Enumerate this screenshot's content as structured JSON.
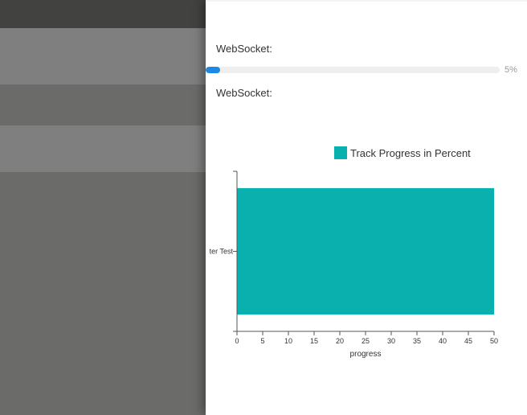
{
  "background": {
    "topbar_color": "#424240",
    "row_color": "#7f7f7f",
    "base_color": "#6b6b69"
  },
  "drawer": {
    "ws_label_1": "WebSocket:",
    "ws_label_2": "WebSocket:",
    "progress": {
      "value_percent": 5,
      "text": "5%",
      "fill_color": "#1e88e5"
    }
  },
  "chart_data": {
    "type": "bar",
    "orientation": "horizontal",
    "categories": [
      "ter Test"
    ],
    "series": [
      {
        "name": "Track Progress in Percent",
        "values": [
          50
        ],
        "color": "#09b0ae"
      }
    ],
    "xlabel": "progress",
    "ylabel": "",
    "xlim": [
      0,
      50
    ],
    "xticks": [
      0,
      5,
      10,
      15,
      20,
      25,
      30,
      35,
      40,
      45,
      50
    ],
    "legend_position": "top",
    "grid": false
  }
}
